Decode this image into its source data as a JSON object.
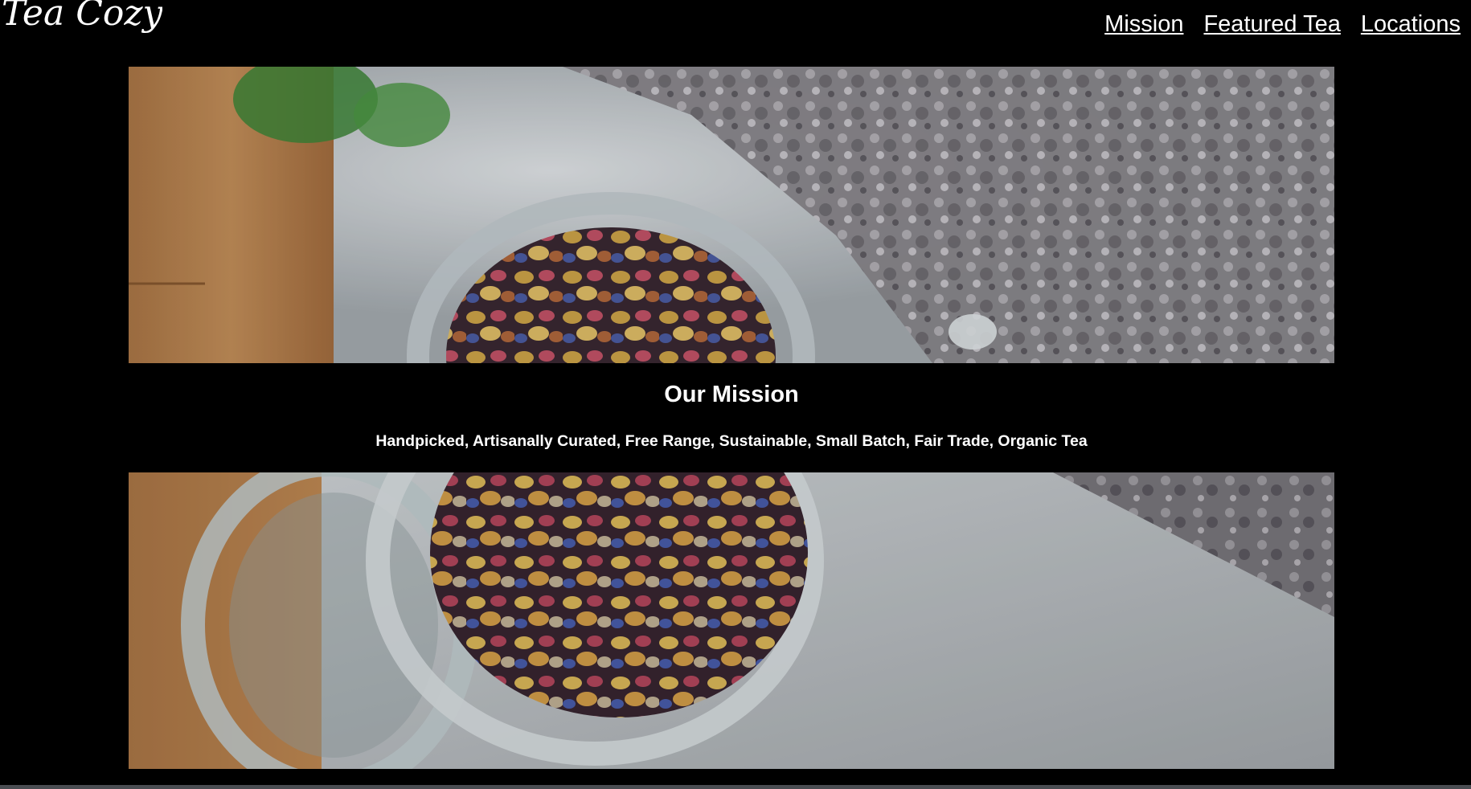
{
  "header": {
    "logo_text": "Tea Cozy",
    "nav": [
      {
        "label": "Mission"
      },
      {
        "label": "Featured Tea"
      },
      {
        "label": "Locations"
      }
    ]
  },
  "mission": {
    "title": "Our Mission",
    "tagline": "Handpicked, Artisanally Curated, Free Range, Sustainable, Small Batch, Fair Trade, Organic Tea"
  },
  "colors": {
    "background": "#000000",
    "text": "#ffffff",
    "footer_bar": "#4a4d52"
  }
}
